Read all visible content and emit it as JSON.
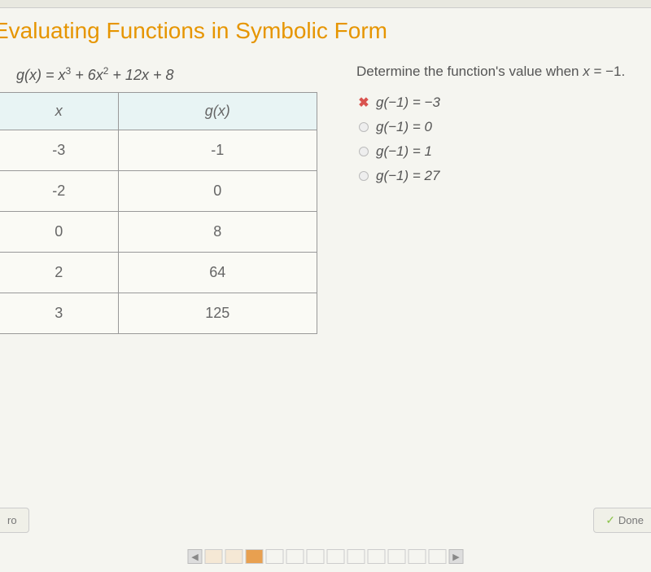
{
  "title": "Evaluating Functions in Symbolic Form",
  "function": {
    "raw": "g(x) = x³ + 6x² + 12x + 8"
  },
  "table": {
    "headers": {
      "x": "x",
      "gx": "g(x)"
    },
    "rows": [
      {
        "x": "-3",
        "gx": "-1"
      },
      {
        "x": "-2",
        "gx": "0"
      },
      {
        "x": "0",
        "gx": "8"
      },
      {
        "x": "2",
        "gx": "64"
      },
      {
        "x": "3",
        "gx": "125"
      }
    ]
  },
  "question": {
    "prompt_prefix": "Determine the function's value when ",
    "prompt_var": "x",
    "prompt_suffix": " = −1."
  },
  "options": [
    {
      "text": "g(−1) = −3",
      "marked_wrong": true
    },
    {
      "text": "g(−1) = 0",
      "marked_wrong": false
    },
    {
      "text": "g(−1) = 1",
      "marked_wrong": false
    },
    {
      "text": "g(−1) = 27",
      "marked_wrong": false
    }
  ],
  "buttons": {
    "intro": "ro",
    "done": "Done"
  },
  "progress": {
    "total_boxes": 12,
    "current_index": 2
  }
}
